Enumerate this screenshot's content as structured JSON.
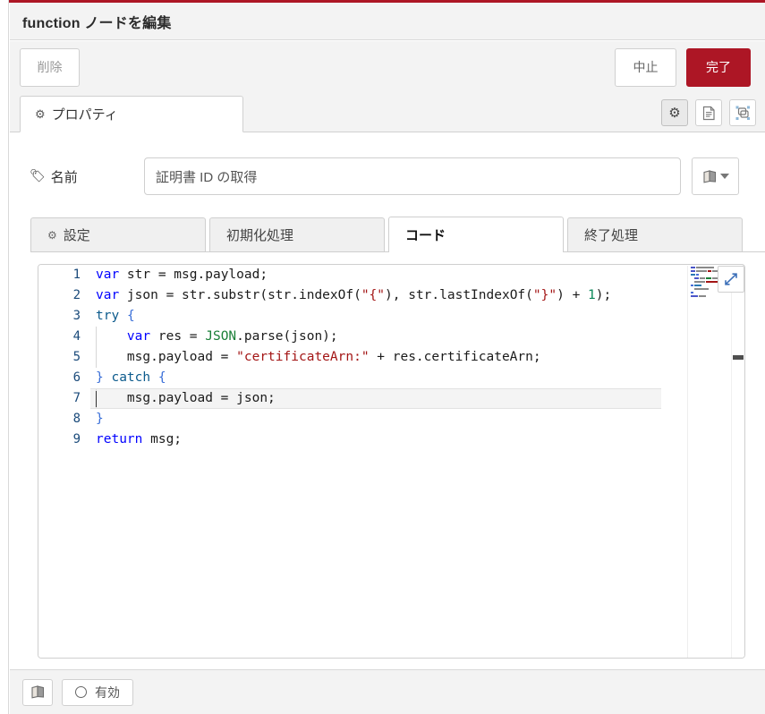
{
  "window": {
    "title": "function ノードを編集",
    "accent_color": "#ad1625"
  },
  "toolbar": {
    "delete_label": "削除",
    "cancel_label": "中止",
    "done_label": "完了"
  },
  "tabs": {
    "main_tab_label": "プロパティ",
    "main_tab_icon": "gear-icon",
    "icon_buttons": [
      {
        "name": "properties-icon",
        "glyph": "gear-icon",
        "active": true
      },
      {
        "name": "description-icon",
        "glyph": "document-icon",
        "active": false
      },
      {
        "name": "appearance-icon",
        "glyph": "node-appearance-icon",
        "active": false
      }
    ]
  },
  "name_field": {
    "label": "名前",
    "label_icon": "tag-icon",
    "value": "証明書 ID の取得",
    "placeholder": "名前",
    "library_button_icon": "book-icon"
  },
  "subtabs": [
    {
      "label": "設定",
      "icon": "gear-icon",
      "active": false
    },
    {
      "label": "初期化処理",
      "icon": "",
      "active": false
    },
    {
      "label": "コード",
      "icon": "",
      "active": true
    },
    {
      "label": "終了処理",
      "icon": "",
      "active": false
    }
  ],
  "editor": {
    "active_line": 7,
    "expand_button_icon": "expand-diagonal-icon",
    "line_numbers": [
      "1",
      "2",
      "3",
      "4",
      "5",
      "6",
      "7",
      "8",
      "9"
    ],
    "code_lines": [
      {
        "n": "1",
        "text": "var str = msg.payload;",
        "tokens": [
          {
            "t": "var",
            "c": "t-kw"
          },
          {
            "t": " str = msg.payload;",
            "c": "t-id"
          }
        ],
        "indent_guides": 0
      },
      {
        "n": "2",
        "text": "var json = str.substr(str.indexOf(\"{\"), str.lastIndexOf(\"}\") + 1);",
        "tokens": [
          {
            "t": "var",
            "c": "t-kw"
          },
          {
            "t": " json = str.substr(str.indexOf(",
            "c": "t-id"
          },
          {
            "t": "\"{\"",
            "c": "t-str"
          },
          {
            "t": "), str.lastIndexOf(",
            "c": "t-id"
          },
          {
            "t": "\"}\"",
            "c": "t-str"
          },
          {
            "t": ") + ",
            "c": "t-id"
          },
          {
            "t": "1",
            "c": "t-num"
          },
          {
            "t": ");",
            "c": "t-id"
          }
        ],
        "indent_guides": 0
      },
      {
        "n": "3",
        "text": "try {",
        "tokens": [
          {
            "t": "try",
            "c": "t-kw2"
          },
          {
            "t": " ",
            "c": "t-id"
          },
          {
            "t": "{",
            "c": "t-brace"
          }
        ],
        "indent_guides": 0
      },
      {
        "n": "4",
        "text": "    var res = JSON.parse(json);",
        "tokens": [
          {
            "t": "    ",
            "c": "t-id"
          },
          {
            "t": "var",
            "c": "t-kw"
          },
          {
            "t": " res = ",
            "c": "t-id"
          },
          {
            "t": "JSON",
            "c": "t-cls"
          },
          {
            "t": ".parse(json);",
            "c": "t-id"
          }
        ],
        "indent_guides": 1
      },
      {
        "n": "5",
        "text": "    msg.payload = \"certificateArn:\" + res.certificateArn;",
        "tokens": [
          {
            "t": "    msg.payload = ",
            "c": "t-id"
          },
          {
            "t": "\"certificateArn:\"",
            "c": "t-str"
          },
          {
            "t": " + res.certificateArn;",
            "c": "t-id"
          }
        ],
        "indent_guides": 1
      },
      {
        "n": "6",
        "text": "} catch {",
        "tokens": [
          {
            "t": "}",
            "c": "t-brace"
          },
          {
            "t": " ",
            "c": "t-id"
          },
          {
            "t": "catch",
            "c": "t-kw2"
          },
          {
            "t": " ",
            "c": "t-id"
          },
          {
            "t": "{",
            "c": "t-brace"
          }
        ],
        "indent_guides": 0
      },
      {
        "n": "7",
        "text": "    msg.payload = json;",
        "tokens": [
          {
            "t": "    msg.payload = json;",
            "c": "t-id"
          }
        ],
        "indent_guides": 1
      },
      {
        "n": "8",
        "text": "}",
        "tokens": [
          {
            "t": "}",
            "c": "t-brace"
          }
        ],
        "indent_guides": 0
      },
      {
        "n": "9",
        "text": "return msg;",
        "tokens": [
          {
            "t": "return",
            "c": "t-kw"
          },
          {
            "t": " msg;",
            "c": "t-id"
          }
        ],
        "indent_guides": 0
      }
    ],
    "minimap_lines": [
      [
        {
          "w": 5,
          "c": "#4a55c8"
        },
        {
          "w": 20,
          "c": "#8a8a8a"
        }
      ],
      [
        {
          "w": 5,
          "c": "#4a55c8"
        },
        {
          "w": 12,
          "c": "#8a8a8a"
        },
        {
          "w": 4,
          "c": "#a31515"
        },
        {
          "w": 14,
          "c": "#8a8a8a"
        }
      ],
      [
        {
          "w": 5,
          "c": "#2a7ab5"
        },
        {
          "w": 3,
          "c": "#4a6fd8"
        }
      ],
      [
        {
          "w": 3,
          "c": "#ffffff"
        },
        {
          "w": 5,
          "c": "#4a55c8"
        },
        {
          "w": 6,
          "c": "#8a8a8a"
        },
        {
          "w": 6,
          "c": "#1a7f37"
        },
        {
          "w": 8,
          "c": "#8a8a8a"
        }
      ],
      [
        {
          "w": 3,
          "c": "#ffffff"
        },
        {
          "w": 12,
          "c": "#8a8a8a"
        },
        {
          "w": 16,
          "c": "#a31515"
        },
        {
          "w": 10,
          "c": "#8a8a8a"
        }
      ],
      [
        {
          "w": 3,
          "c": "#4a6fd8"
        },
        {
          "w": 8,
          "c": "#2a7ab5"
        }
      ],
      [
        {
          "w": 3,
          "c": "#ffffff"
        },
        {
          "w": 16,
          "c": "#8a8a8a"
        }
      ],
      [
        {
          "w": 3,
          "c": "#4a6fd8"
        }
      ],
      [
        {
          "w": 8,
          "c": "#4a55c8"
        },
        {
          "w": 8,
          "c": "#8a8a8a"
        }
      ]
    ]
  },
  "footer": {
    "library_icon": "book-icon",
    "enabled_label": "有効",
    "enabled_icon": "circle-icon"
  }
}
